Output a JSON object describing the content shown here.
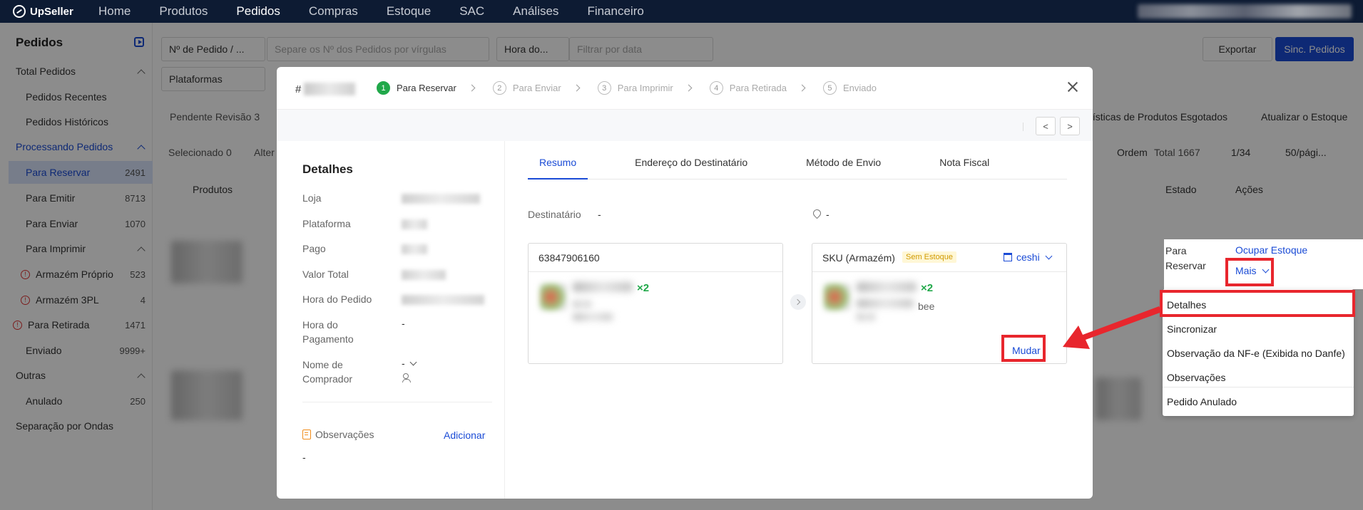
{
  "app": {
    "brand": "UpSeller"
  },
  "topnav": {
    "items": [
      "Home",
      "Produtos",
      "Pedidos",
      "Compras",
      "Estoque",
      "SAC",
      "Análises",
      "Financeiro"
    ],
    "active": "Pedidos"
  },
  "sidebar": {
    "title": "Pedidos",
    "rows": [
      {
        "label": "Total Pedidos",
        "count": "",
        "kind": "group"
      },
      {
        "label": "Pedidos Recentes",
        "count": "",
        "kind": "sub"
      },
      {
        "label": "Pedidos Históricos",
        "count": "",
        "kind": "sub"
      },
      {
        "label": "Processando Pedidos",
        "count": "",
        "kind": "group-active"
      },
      {
        "label": "Para Reservar",
        "count": "2491",
        "kind": "selected"
      },
      {
        "label": "Para Emitir",
        "count": "8713",
        "kind": "sub"
      },
      {
        "label": "Para Enviar",
        "count": "1070",
        "kind": "sub"
      },
      {
        "label": "Para Imprimir",
        "count": "",
        "kind": "sub-group"
      },
      {
        "label": "Armazém Próprio",
        "count": "523",
        "kind": "warn"
      },
      {
        "label": "Armazém 3PL",
        "count": "4",
        "kind": "warn"
      },
      {
        "label": "Para Retirada",
        "count": "1471",
        "kind": "warn-sub"
      },
      {
        "label": "Enviado",
        "count": "9999+",
        "kind": "sub"
      },
      {
        "label": "Outras",
        "count": "",
        "kind": "group"
      },
      {
        "label": "Anulado",
        "count": "250",
        "kind": "sub"
      },
      {
        "label": "Separação por Ondas",
        "count": "",
        "kind": "group"
      }
    ]
  },
  "filters": {
    "order_type": "Nº de Pedido / ...",
    "order_placeholder": "Separe os Nº dos Pedidos por vírgulas",
    "time_type": "Hora do...",
    "date_placeholder": "Filtrar por data",
    "platforms": "Plataformas",
    "export_label": "Exportar",
    "sync_label": "Sinc. Pedidos"
  },
  "background": {
    "tab_pending": "Pendente Revisão",
    "tab_pending_count": "3",
    "tab_stats": "tísticas de Produtos Esgotados",
    "update_stock": "Atualizar o Estoque",
    "selected_label": "Selecionado",
    "selected_count": "0",
    "alter_label": "Alter",
    "order_sort": "Ordem",
    "total_label": "Total 1667",
    "page_info": "1/34",
    "per_page": "50/pági...",
    "col_products": "Produtos",
    "col_state": "Estado",
    "col_actions": "Ações",
    "state_value": "Para\nReservar",
    "occupy_stock": "Ocupar Estoque",
    "more_label": "Mais"
  },
  "modal": {
    "order_prefix": "#",
    "steps": [
      {
        "num": "1",
        "label": "Para Reservar",
        "active": true
      },
      {
        "num": "2",
        "label": "Para Enviar",
        "active": false
      },
      {
        "num": "3",
        "label": "Para Imprimir",
        "active": false
      },
      {
        "num": "4",
        "label": "Para Retirada",
        "active": false
      },
      {
        "num": "5",
        "label": "Enviado",
        "active": false
      }
    ],
    "prev": "<",
    "next": ">",
    "details": {
      "title": "Detalhes",
      "store": "Loja",
      "platform": "Plataforma",
      "paid": "Pago",
      "total_value": "Valor Total",
      "order_time": "Hora do Pedido",
      "payment_time": "Hora do\nPagamento",
      "payment_time_value": "-",
      "buyer_name": "Nome de\nComprador",
      "buyer_value": "-",
      "notes": "Observações",
      "add": "Adicionar",
      "notes_value": "-"
    },
    "tabs": [
      "Resumo",
      "Endereço do Destinatário",
      "Método de Envio",
      "Nota Fiscal"
    ],
    "recipient_label": "Destinatário",
    "recipient_value": "-",
    "location_value": "-",
    "left_box": {
      "title": "63847906160",
      "qty": "×2"
    },
    "right_box": {
      "title": "SKU (Armazém)",
      "badge": "Sem Estoque",
      "warehouse": "ceshi",
      "qty": "×2",
      "suffix": "bee",
      "change": "Mudar"
    }
  },
  "dropdown": {
    "items": [
      "Detalhes",
      "Sincronizar",
      "Observação da NF-e (Exibida no Danfe)",
      "Observações",
      "Pedido Anulado"
    ]
  },
  "colors": {
    "accent": "#1a4bd6",
    "nav_bg": "#0d1b33",
    "highlight_red": "#e8262d",
    "success": "#21a84a"
  }
}
